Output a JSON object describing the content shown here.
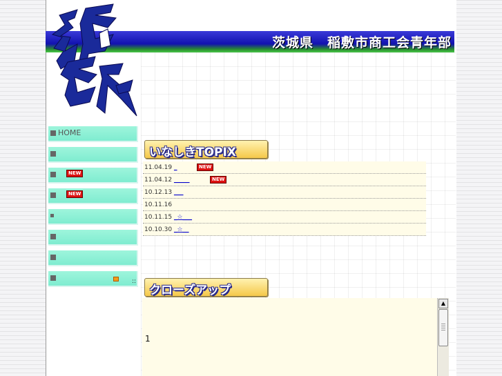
{
  "header": {
    "title": "茨城県　稲敷市商工会青年部"
  },
  "logo": {
    "text": "稲敷"
  },
  "sidebar": {
    "items": [
      {
        "label": "HOME",
        "badge": ""
      },
      {
        "label": "",
        "badge": ""
      },
      {
        "label": "",
        "badge": "NEW"
      },
      {
        "label": "",
        "badge": "NEW"
      },
      {
        "label": "",
        "badge": ""
      },
      {
        "label": "",
        "badge": ""
      },
      {
        "label": "",
        "badge": ""
      },
      {
        "label": "",
        "badge": ""
      }
    ],
    "tiny_text": "::"
  },
  "topix": {
    "title": "いなしきTOPIX",
    "rows": [
      {
        "date": "11.04.19",
        "link": "_",
        "badge": "NEW"
      },
      {
        "date": "11.04.12",
        "link": "_____",
        "badge": "NEW"
      },
      {
        "date": "10.12.13",
        "link": "___",
        "badge": ""
      },
      {
        "date": "10.11.16",
        "link": "",
        "badge": ""
      },
      {
        "date": "10.11.15",
        "link": "_☆___",
        "badge": ""
      },
      {
        "date": "10.10.30",
        "link": "_☆__",
        "badge": ""
      }
    ]
  },
  "closeup": {
    "title": "クローズアップ",
    "text": "1",
    "scroll_up_glyph": "▲"
  },
  "colors": {
    "header_blue": "#1212b0",
    "header_green": "#46c746",
    "nav_bg": "#8ff0d6",
    "badge_red": "#dd1111"
  }
}
